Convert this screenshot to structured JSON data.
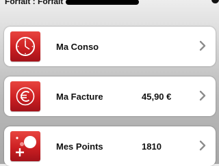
{
  "header": {
    "forfait_text": "Forfait : Forfait"
  },
  "menu": {
    "items": [
      {
        "label": "Ma Conso",
        "value": "",
        "icon": "clock-icon"
      },
      {
        "label": "Ma Facture",
        "value": "45,90 €",
        "icon": "euro-icon"
      },
      {
        "label": "Mes Points",
        "value": "1810",
        "icon": "points-icon"
      }
    ]
  },
  "colors": {
    "accent_red": "#cc1f22",
    "chevron_gray": "#8c8c8c"
  }
}
